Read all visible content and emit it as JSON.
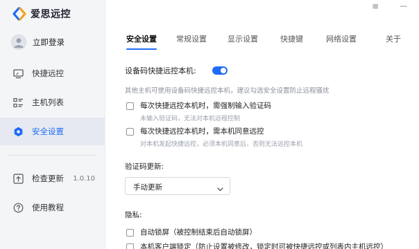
{
  "app": {
    "name": "爱思远控"
  },
  "window_controls": {
    "menu": "≡",
    "minimize": "—"
  },
  "sidebar": {
    "login_label": "立即登录",
    "items": [
      {
        "label": "快捷远控",
        "icon": "monitor-icon"
      },
      {
        "label": "主机列表",
        "icon": "list-grid-icon"
      },
      {
        "label": "安全设置",
        "icon": "shield-hexagon-icon",
        "active": true
      },
      {
        "label": "检查更新",
        "icon": "update-arrow-icon",
        "version": "1.0.10"
      },
      {
        "label": "使用教程",
        "icon": "help-circle-icon"
      }
    ]
  },
  "tabs": [
    {
      "label": "安全设置",
      "active": true
    },
    {
      "label": "常规设置"
    },
    {
      "label": "显示设置"
    },
    {
      "label": "快捷键"
    },
    {
      "label": "网络设置"
    },
    {
      "label": "关于"
    }
  ],
  "security": {
    "quick_control_label": "设备码快捷远控本机:",
    "quick_control_enabled": true,
    "quick_control_hint": "其他主机可使用设备码快捷远控本机，建议勾选安全设置防止远程骚扰",
    "options": [
      {
        "label": "每次快捷远控本机时，需强制输入验证码",
        "hint": "未输入验证码，无法对本机远程控制",
        "checked": false
      },
      {
        "label": "每次快捷远控本机时，需本机同意远控",
        "hint": "对本机发起快捷远控，必须本机同意后，否则无法远控本机",
        "checked": false
      }
    ],
    "code_update_label": "验证码更新:",
    "code_update_value": "手动更新",
    "privacy_label": "隐私:",
    "privacy_options": [
      {
        "label": "自动锁屏（被控制结束后自动锁屏）",
        "checked": false
      },
      {
        "label": "本机客户端锁定（防止设置被修改，锁定时可被快捷远控或列表内主机远控）",
        "checked": false
      }
    ]
  },
  "colors": {
    "accent": "#1f6bf5",
    "sidebar_bg": "#f4f5f7",
    "active_item_bg": "#e6e9f1"
  }
}
